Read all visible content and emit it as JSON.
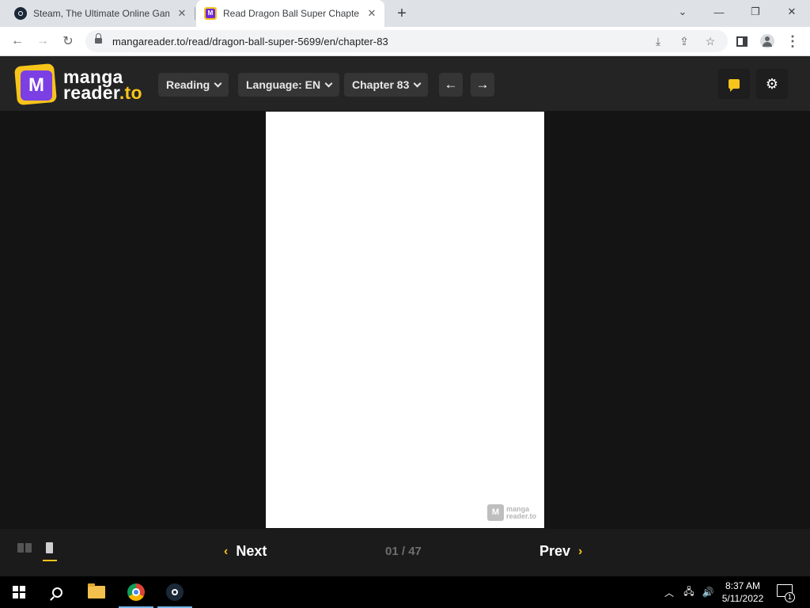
{
  "browser": {
    "tabs": [
      {
        "title": "Steam, The Ultimate Online Gam",
        "favicon": "steam-icon"
      },
      {
        "title": "Read Dragon Ball Super Chapter",
        "favicon": "mangareader-icon"
      }
    ],
    "new_tab": "+",
    "url": "mangareader.to/read/dragon-ball-super-5699/en/chapter-83"
  },
  "site": {
    "logo_line1": "manga",
    "logo_line2": "reader",
    "logo_tld": ".to",
    "logo_badge": "M",
    "brand_color": "#f7c41b",
    "accent_color": "#7b3fe4",
    "reading_mode": "Reading",
    "language": "Language: EN",
    "chapter": "Chapter 83"
  },
  "reader": {
    "watermark_badge": "M",
    "watermark_line1": "manga",
    "watermark_line2": "reader.to",
    "next_label": "Next",
    "prev_label": "Prev",
    "current_page": "01",
    "separator": "/",
    "total_pages": "47"
  },
  "taskbar": {
    "time": "8:37 AM",
    "date": "5/11/2022",
    "notification_count": "1"
  }
}
